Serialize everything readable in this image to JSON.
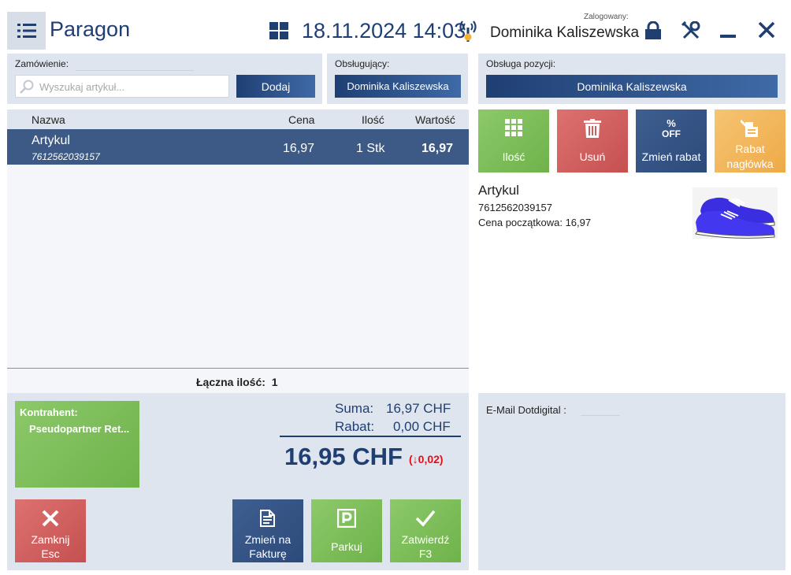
{
  "header": {
    "title": "Paragon",
    "datetime": "18.11.2024 14:03",
    "logged_label": "Zalogowany:",
    "user_name": "Dominika Kaliszewska"
  },
  "order": {
    "label": "Zamówienie:",
    "search_placeholder": "Wyszukaj artykuł...",
    "add_label": "Dodaj"
  },
  "serving": {
    "label": "Obsługujący:",
    "value": "Dominika Kaliszewska"
  },
  "position_service": {
    "label": "Obsługa pozycji:",
    "value": "Dominika Kaliszewska"
  },
  "table": {
    "columns": [
      "Nazwa",
      "Cena",
      "Ilość",
      "Wartość"
    ],
    "rows": [
      {
        "name": "Artykul",
        "code": "7612562039157",
        "price": "16,97",
        "qty": "1 Stk",
        "value": "16,97"
      }
    ],
    "total_qty": "Łączna ilość:  1"
  },
  "actions": {
    "qty": "Ilość",
    "delete": "Usuń",
    "change_discount": "Zmień rabat",
    "discount_icon_text": "%",
    "discount_icon_off": "OFF",
    "header_discount_line1": "Rabat",
    "header_discount_line2": "nagłówka"
  },
  "detail": {
    "name": "Artykul",
    "code": "7612562039157",
    "initial_price": "Cena początkowa: 16,97"
  },
  "summary": {
    "contractor_label": "Kontrahent:",
    "contractor_name": "Pseudopartner Ret...",
    "sum_label": "Suma:",
    "sum_value": "16,97 CHF",
    "discount_label": "Rabat:",
    "discount_value": "0,00 CHF",
    "total": "16,95 CHF",
    "total_diff": "(↓0,02)"
  },
  "bottom_buttons": {
    "close_line1": "Zamknij",
    "close_line2": "Esc",
    "invoice_line1": "Zmień na",
    "invoice_line2": "Fakturę",
    "park": "Parkuj",
    "confirm_line1": "Zatwierdź",
    "confirm_line2": "F3"
  },
  "email": {
    "label": "E-Mail Dotdigital :"
  },
  "colors": {
    "primary": "#1f3f73",
    "green": "#79bb55",
    "red": "#cf5e5c",
    "orange": "#f1b656",
    "selected_row": "#3c5a85",
    "panel": "#dfe5ee",
    "diff_red": "#e0101a"
  },
  "icons": {
    "menu": "list-menu-icon",
    "grid": "grid-icon",
    "antenna": "antenna-icon",
    "lock": "lock-icon",
    "tools": "tools-icon",
    "minimize": "minimize-icon",
    "close": "close-icon",
    "search": "search-icon"
  }
}
